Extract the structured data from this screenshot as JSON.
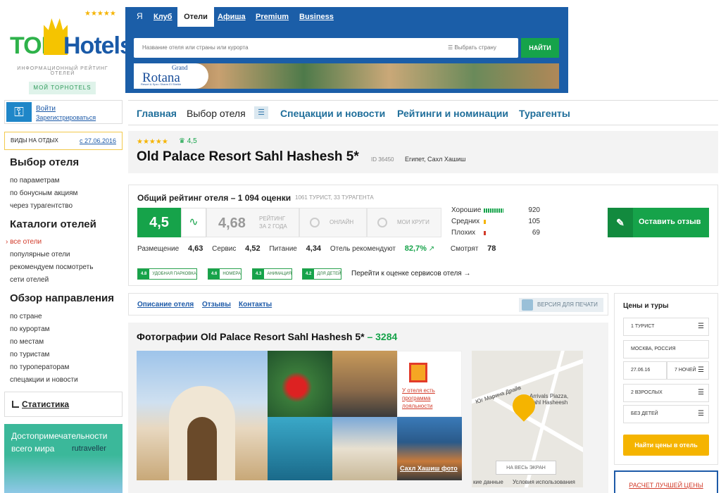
{
  "logo": {
    "top": "TOP",
    "hotels": "Hotels",
    "stars": "★★★★★",
    "tagline": "ИНФОРМАЦИОННЫЙ РЕЙТИНГ ОТЕЛЕЙ",
    "my_label": "МОЙ TOPHOTELS"
  },
  "login": {
    "signin": "Войти",
    "register": "Зарегистрироваться"
  },
  "vacation": {
    "label": "ВИДЫ НА ОТДЫХ",
    "date": "с 27.06.2016"
  },
  "sidebar": {
    "choose_title": "Выбор отеля",
    "choose_links": [
      "по параметрам",
      "по бонусным акциям",
      "через турагентство"
    ],
    "catalog_title": "Каталоги отелей",
    "catalog_links": [
      "все отели",
      "популярные отели",
      "рекомендуем посмотреть",
      "сети отелей"
    ],
    "dest_title": "Обзор направления",
    "dest_links": [
      "по стране",
      "по курортам",
      "по местам",
      "по туристам",
      "по туроператорам",
      "спецакции и новости"
    ],
    "stats": "Статистика",
    "banner_line1": "Достопримечательности",
    "banner_line2": "всего мира",
    "banner_brand": "rutraveller"
  },
  "topnav": {
    "ya": "Я",
    "items": [
      "Клуб",
      "Отели",
      "Афиша",
      "Premium",
      "Business"
    ]
  },
  "search": {
    "placeholder": "Название отеля или страны или курорта",
    "country": "Выбрать страну",
    "button": "НАЙТИ"
  },
  "ad": {
    "grand": "Grand",
    "brand": "Rotana",
    "sub": "Resort & Spa • Sharm El Sheikh"
  },
  "mainnav": [
    "Главная",
    "Выбор отеля",
    "Спецакции и новости",
    "Рейтинги и номинации",
    "Турагенты"
  ],
  "hotel": {
    "stars": "★★★★★",
    "rating": "4,5",
    "name": "Old Palace Resort Sahl Hashesh 5*",
    "id": "ID 36450",
    "location": "Египет, Сахл Хашиш"
  },
  "rating": {
    "title": "Общий рейтинг отеля – 1 094 оценки",
    "subtitle": "1061 ТУРИСТ, 33 ТУРАГЕНТА",
    "score": "4,5",
    "trend_icon": "trend-icon",
    "score2": "4,68",
    "score2_label1": "РЕЙТИНГ",
    "score2_label2": "ЗА 2 ГОДА",
    "online": "ОНЛАЙН",
    "circles": "МОИ КРУГИ",
    "dist": [
      {
        "label": "Хорошие",
        "count": "920",
        "color": "#16a34a"
      },
      {
        "label": "Средних",
        "count": "105",
        "color": "#f5b400"
      },
      {
        "label": "Плохих",
        "count": "69",
        "color": "#d23b2a"
      }
    ],
    "review_button": "Оставить отзыв",
    "sub": [
      {
        "label": "Размещение",
        "value": "4,63"
      },
      {
        "label": "Сервис",
        "value": "4,52"
      },
      {
        "label": "Питание",
        "value": "4,34"
      }
    ],
    "recommend_label": "Отель рекомендуют",
    "recommend_value": "82,7%",
    "views_label": "Смотрят",
    "views_value": "78",
    "chips": [
      {
        "score": "4.8",
        "label": "УДОБНАЯ ПАРКОВКА"
      },
      {
        "score": "4.6",
        "label": "НОМЕРА"
      },
      {
        "score": "4.3",
        "label": "АНИМАЦИЯ"
      },
      {
        "score": "4.2",
        "label": "ДЛЯ ДЕТЕЙ"
      }
    ],
    "chips_link": "Перейти к оценке сервисов отеля →"
  },
  "tabs": [
    "Описание отеля",
    "Отзывы",
    "Контакты"
  ],
  "print": "ВЕРСИЯ ДЛЯ ПЕЧАТИ",
  "photos": {
    "title": "Фотографии Old Palace Resort Sahl Hashesh 5*",
    "count": "– 3284",
    "loyalty": "У отеля есть программа лояльности",
    "caption": "Сахл Хашиш фото",
    "map_street": "Юг Марина Драйв",
    "map_place": "Arrivals Piazza, Sahl Hasheesh",
    "map_full": "НА ВЕСЬ ЭКРАН",
    "map_data": "кие данные",
    "map_terms": "Условия использования"
  },
  "prices": {
    "title": "Цены и туры",
    "fields": [
      "1 ТУРИСТ",
      "МОСКВА, РОССИЯ",
      "27.06.16",
      "7 НОЧЕЙ",
      "2 ВЗРОСЛЫХ",
      "БЕЗ ДЕТЕЙ"
    ],
    "button": "Найти цены в отель",
    "best": "РАСЧЕТ ЛУЧШЕЙ ЦЕНЫ"
  }
}
